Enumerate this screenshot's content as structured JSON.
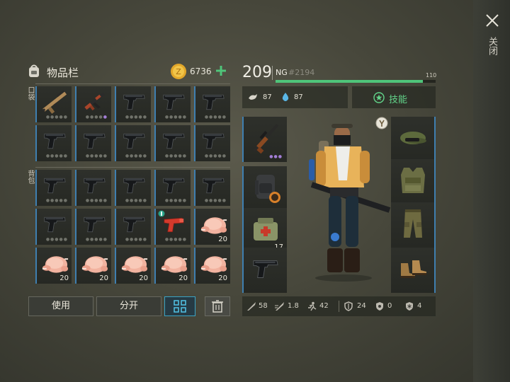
{
  "close": {
    "label": "关闭",
    "icon": "close-icon"
  },
  "inventory": {
    "title": "物品栏",
    "currency_amount": "6736",
    "currency_icon": "gold-coin-icon",
    "pocket_label": "口袋",
    "backpack_label": "背包",
    "pocket_slots": [
      {
        "item": "assault-rifle-tan"
      },
      {
        "item": "ak-rifle"
      },
      {
        "item": "pistol"
      },
      {
        "item": "pistol"
      },
      {
        "item": "pistol"
      },
      {
        "item": "pistol"
      },
      {
        "item": "pistol"
      },
      {
        "item": "pistol"
      },
      {
        "item": "pistol"
      },
      {
        "item": "pistol"
      }
    ],
    "backpack_slots": [
      {
        "item": "pistol"
      },
      {
        "item": "pistol"
      },
      {
        "item": "pistol"
      },
      {
        "item": "pistol"
      },
      {
        "item": "pistol"
      },
      {
        "item": "pistol"
      },
      {
        "item": "pistol"
      },
      {
        "item": "pistol"
      },
      {
        "item": "flare-gun"
      },
      {
        "item": "raw-chicken",
        "qty": "20"
      },
      {
        "item": "raw-chicken",
        "qty": "20"
      },
      {
        "item": "raw-chicken",
        "qty": "20"
      },
      {
        "item": "raw-chicken",
        "qty": "20"
      },
      {
        "item": "raw-chicken",
        "qty": "20"
      },
      {
        "item": "raw-chicken",
        "qty": "20"
      }
    ],
    "buttons": {
      "use": "使用",
      "split": "分开"
    }
  },
  "character": {
    "level": "209",
    "name": "NG",
    "id": "#2194",
    "xp_label": "110",
    "xp_progress": 0.92,
    "hunger": "87",
    "thirst": "87",
    "skills_label": "技能",
    "equipment_left": [
      {
        "item": "sniper-rifle"
      },
      {
        "item": "backpack"
      },
      {
        "item": "medkit",
        "qty": "17"
      },
      {
        "item": "pistol"
      }
    ],
    "equipment_right": [
      {
        "item": "camo-cap"
      },
      {
        "item": "camo-vest"
      },
      {
        "item": "camo-pants"
      },
      {
        "item": "boots"
      }
    ],
    "stats": {
      "melee": "58",
      "attack_speed": "1.8",
      "move_speed": "42",
      "armor": "24",
      "radiation": "0",
      "cold": "4"
    }
  },
  "colors": {
    "accent_green": "#4fc57a",
    "slot_edge": "#3f7fb0",
    "rare_purple": "#a37ed6"
  }
}
